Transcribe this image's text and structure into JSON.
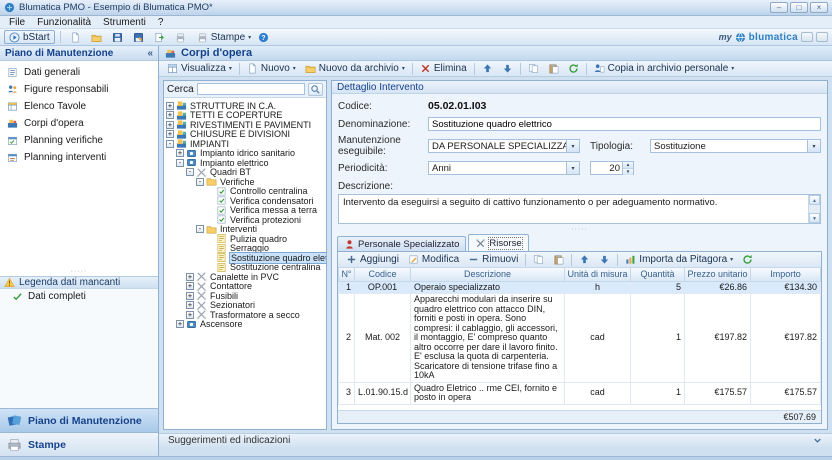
{
  "theme": {
    "accent": "#15428b",
    "brand_blue": "#2f80c3",
    "selection": "#c9e2f9",
    "warning_yellow": "#f9c74f",
    "check_green": "#3a9e3d"
  },
  "window": {
    "title": "Blumatica PMO - Esempio di Blumatica PMO*",
    "controls": {
      "minimize": "–",
      "maximize": "□",
      "close": "×"
    }
  },
  "menu": {
    "items": [
      "File",
      "Funzionalità",
      "Strumenti",
      "?"
    ]
  },
  "toolbar": {
    "bstart_label": "bStart",
    "icon_buttons": [
      "new-document",
      "open-folder",
      "save",
      "save-as",
      "export",
      "print-preview"
    ],
    "stampe_label": "Stampe",
    "brand": {
      "prefix": "my",
      "name": "blumatica"
    }
  },
  "sidebar": {
    "header": "Piano di Manutenzione",
    "collapse_glyph": "«",
    "items": [
      {
        "label": "Dati generali",
        "icon": "general-data"
      },
      {
        "label": "Figure responsabili",
        "icon": "responsible-figures"
      },
      {
        "label": "Elenco Tavole",
        "icon": "tables-list"
      },
      {
        "label": "Corpi d'opera",
        "icon": "works"
      },
      {
        "label": "Planning verifiche",
        "icon": "planning-checks"
      },
      {
        "label": "Planning interventi",
        "icon": "planning-interventions"
      }
    ],
    "legend": {
      "header": "Legenda dati mancanti",
      "item": "Dati completi"
    },
    "bottom_items": [
      {
        "label": "Piano di Manutenzione",
        "icon": "pages-blue",
        "active": true
      },
      {
        "label": "Stampe",
        "icon": "printer-big",
        "active": false
      }
    ]
  },
  "main": {
    "header": "Corpi d'opera",
    "toolbar_buttons": [
      {
        "icon": "grid",
        "label": "Visualizza",
        "caret": true
      },
      {
        "icon": "new-document",
        "label": "Nuovo",
        "caret": true,
        "sep_before": true
      },
      {
        "icon": "open-folder",
        "label": "Nuovo da archivio",
        "caret": true
      },
      {
        "icon": "delete-x",
        "label": "Elimina",
        "sep_before": true
      },
      {
        "icon": "arrow-up",
        "sep_before": true
      },
      {
        "icon": "arrow-down"
      },
      {
        "icon": "copy",
        "sep_before": true
      },
      {
        "icon": "paste"
      },
      {
        "icon": "refresh"
      },
      {
        "icon": "copy-personal",
        "label": "Copia in archivio personale",
        "caret": true,
        "sep_before": true
      }
    ],
    "search_label": "Cerca",
    "search_value": "",
    "tree": [
      {
        "label": "STRUTTURE IN C.A.",
        "level": 0,
        "expander": "plus",
        "icon": "category-block"
      },
      {
        "label": "TETTI E COPERTURE",
        "level": 0,
        "expander": "plus",
        "icon": "category-block"
      },
      {
        "label": "RIVESTIMENTI E PAVIMENTI",
        "level": 0,
        "expander": "plus",
        "icon": "category-block"
      },
      {
        "label": "CHIUSURE E DIVISIONI",
        "level": 0,
        "expander": "plus",
        "icon": "category-block"
      },
      {
        "label": "IMPIANTI",
        "level": 0,
        "expander": "minus",
        "icon": "category-block"
      },
      {
        "label": "Impianto idrico sanitario",
        "level": 1,
        "expander": "plus",
        "icon": "system"
      },
      {
        "label": "Impianto elettrico",
        "level": 1,
        "expander": "minus",
        "icon": "system"
      },
      {
        "label": "Quadri BT",
        "level": 2,
        "expander": "minus",
        "icon": "equipment-tools"
      },
      {
        "label": "Verifiche",
        "level": 3,
        "expander": "minus",
        "icon": "folder"
      },
      {
        "label": "Controllo centralina",
        "level": 4,
        "expander": "none",
        "icon": "check-task"
      },
      {
        "label": "Verifica condensatori",
        "level": 4,
        "expander": "none",
        "icon": "check-task"
      },
      {
        "label": "Verifica messa a terra",
        "level": 4,
        "expander": "none",
        "icon": "check-task"
      },
      {
        "label": "Verifica protezioni",
        "level": 4,
        "expander": "none",
        "icon": "check-task"
      },
      {
        "label": "Interventi",
        "level": 3,
        "expander": "minus",
        "icon": "folder"
      },
      {
        "label": "Pulizia quadro",
        "level": 4,
        "expander": "none",
        "icon": "task-note"
      },
      {
        "label": "Serraggio",
        "level": 4,
        "expander": "none",
        "icon": "task-note"
      },
      {
        "label": "Sostituzione quadro elettrico",
        "level": 4,
        "expander": "none",
        "icon": "task-note",
        "selected": true
      },
      {
        "label": "Sostituzione centralina",
        "level": 4,
        "expander": "none",
        "icon": "task-note"
      },
      {
        "label": "Canalette in PVC",
        "level": 2,
        "expander": "plus",
        "icon": "equipment-tools"
      },
      {
        "label": "Contattore",
        "level": 2,
        "expander": "plus",
        "icon": "equipment-tools"
      },
      {
        "label": "Fusibili",
        "level": 2,
        "expander": "plus",
        "icon": "equipment-tools"
      },
      {
        "label": "Sezionatori",
        "level": 2,
        "expander": "plus",
        "icon": "equipment-tools"
      },
      {
        "label": "Trasformatore a secco",
        "level": 2,
        "expander": "plus",
        "icon": "equipment-tools"
      },
      {
        "label": "Ascensore",
        "level": 1,
        "expander": "plus",
        "icon": "system"
      }
    ],
    "detail": {
      "header": "Dettaglio Intervento",
      "fields": {
        "codice_label": "Codice:",
        "codice": "05.02.01.I03",
        "denominazione_label": "Denominazione:",
        "denominazione": "Sostituzione quadro elettrico",
        "manutenzione_label": "Manutenzione eseguibile:",
        "manutenzione": "DA PERSONALE SPECIALIZZATO",
        "tipologia_label": "Tipologia:",
        "tipologia": "Sostituzione",
        "periodicita_label": "Periodicità:",
        "periodicita": "Anni",
        "periodicita_valore": "20",
        "descrizione_label": "Descrizione:",
        "descrizione": "Intervento da eseguirsi a seguito di cattivo funzionamento o per adeguamento normativo."
      },
      "tabs": [
        {
          "label": "Personale Specializzato",
          "icon": "person-red",
          "active": false
        },
        {
          "label": "Risorse",
          "icon": "tools-tab",
          "active": true
        }
      ],
      "grid_toolbar_buttons": [
        {
          "icon": "add-plus",
          "label": "Aggiungi"
        },
        {
          "icon": "edit-note",
          "label": "Modifica"
        },
        {
          "icon": "remove-minus",
          "label": "Rimuovi"
        },
        {
          "icon": "copy",
          "sep_before": true
        },
        {
          "icon": "paste"
        },
        {
          "icon": "arrow-up",
          "sep_before": true
        },
        {
          "icon": "arrow-down"
        },
        {
          "icon": "import-chart",
          "label": "Importa da Pitagora",
          "caret": true,
          "sep_before": true
        },
        {
          "icon": "refresh"
        }
      ],
      "table": {
        "columns": [
          "N°",
          "Codice",
          "Descrizione",
          "Unità di misura",
          "Quantità",
          "Prezzo unitario",
          "Importo"
        ],
        "rows": [
          {
            "n": "1",
            "codice": "OP.001",
            "descrizione": "Operaio specializzato",
            "unita": "h",
            "quantita": "5",
            "prezzo": "€26.86",
            "importo": "€134.30",
            "selected": true
          },
          {
            "n": "2",
            "codice": "Mat. 002",
            "descrizione": "Apparecchi modulari da inserire su quadro elettrico con attacco DIN, forniti e posti in opera. Sono compresi: il cablaggio, gli accessori, il montaggio, E' compreso quanto altro occorre per dare il lavoro finito. E' esclusa la quota di carpenteria. Scaricatore di tensione trifase fino a 10kA",
            "unita": "cad",
            "quantita": "1",
            "prezzo": "€197.82",
            "importo": "€197.82",
            "selected": false
          },
          {
            "n": "3",
            "codice": "L.01.90.15.d",
            "descrizione": "Quadro Eletrico .. rme CEI, fornito e posto in opera",
            "unita": "cad",
            "quantita": "1",
            "prezzo": "€175.57",
            "importo": "€175.57",
            "selected": false
          }
        ],
        "total": "€507.69"
      }
    },
    "statusbar": "Suggerimenti ed indicazioni"
  }
}
